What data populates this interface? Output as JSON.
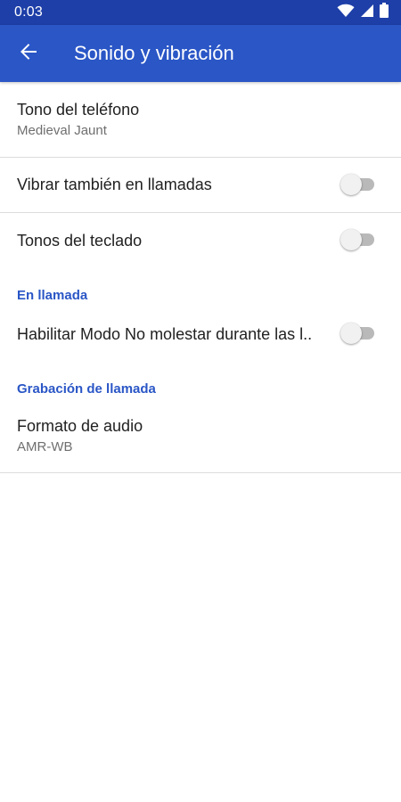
{
  "status_bar": {
    "time": "0:03",
    "icons": [
      "wifi-icon",
      "signal-icon",
      "battery-icon"
    ]
  },
  "app_bar": {
    "title": "Sonido y vibración",
    "back_icon": "arrow-back-icon"
  },
  "colors": {
    "status_bar": "#1e3fa8",
    "app_bar": "#2a56c6",
    "accent": "#2a56c6",
    "divider": "#dcdcdc"
  },
  "preferences": {
    "ringtone": {
      "title": "Tono del teléfono",
      "summary": "Medieval Jaunt"
    },
    "vibrate": {
      "title": "Vibrar también en llamadas",
      "checked": false
    },
    "dialpad_tones": {
      "title": "Tonos del teclado",
      "checked": false
    },
    "in_call_category": "En llamada",
    "dnd": {
      "title": "Habilitar Modo No molestar durante las l..",
      "checked": false
    },
    "call_recording_category": "Grabación de llamada",
    "audio_format": {
      "title": "Formato de audio",
      "summary": "AMR-WB"
    }
  }
}
